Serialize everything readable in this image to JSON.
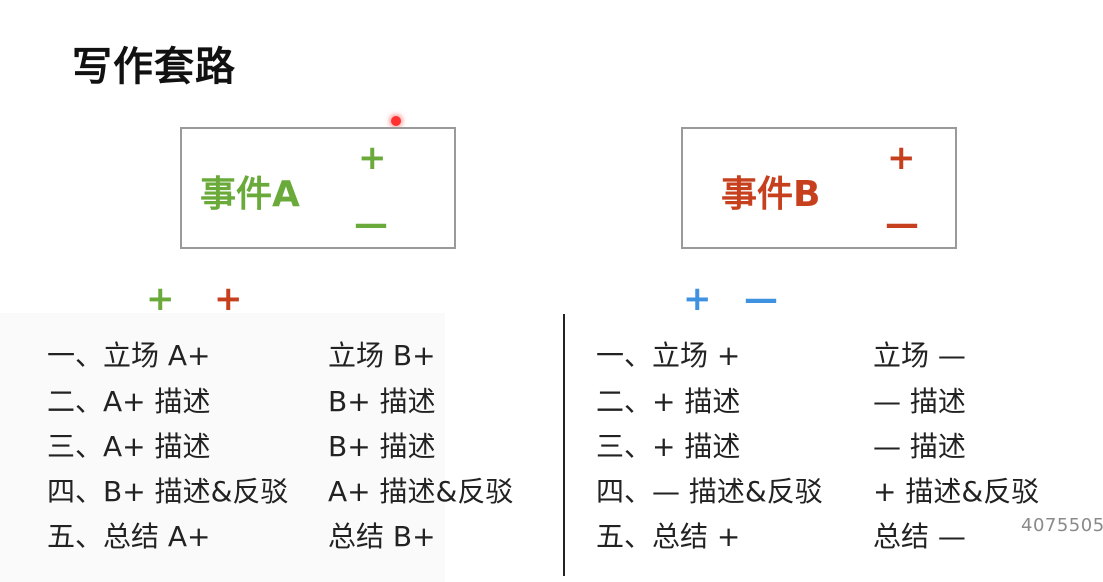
{
  "title": "写作套路",
  "events": {
    "a": {
      "label": "事件A",
      "plus": "+",
      "minus": "—",
      "color": "#6aaa3a"
    },
    "b": {
      "label": "事件B",
      "plus": "+",
      "minus": "—",
      "color": "#c7401e"
    }
  },
  "sign_pairs": {
    "left": [
      "+",
      "+"
    ],
    "right": [
      "+",
      "—"
    ]
  },
  "left_table": {
    "col1": [
      "一、立场 A+",
      "二、A+ 描述",
      "三、A+ 描述",
      "四、B+ 描述&反驳",
      "五、总结 A+"
    ],
    "col2": [
      "立场 B+",
      "B+ 描述",
      "B+ 描述",
      "A+ 描述&反驳",
      "总结 B+"
    ]
  },
  "right_table": {
    "col1": [
      "一、立场 +",
      "二、+ 描述",
      "三、+ 描述",
      "四、— 描述&反驳",
      "五、总结 +"
    ],
    "col2": [
      "立场 —",
      "— 描述",
      "— 描述",
      "+ 描述&反驳",
      "总结 —"
    ]
  },
  "watermark": "4075505"
}
